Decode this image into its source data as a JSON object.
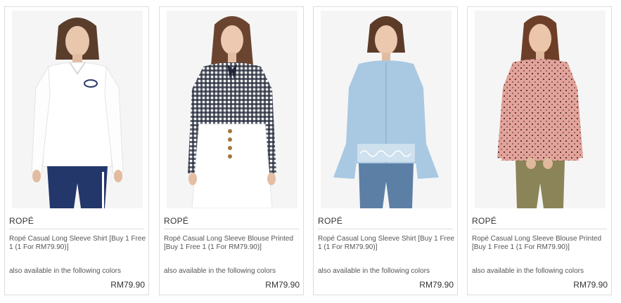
{
  "products": [
    {
      "brand": "ROPÉ",
      "name": "Ropé Casual Long Sleeve Shirt [Buy 1 Free 1 (1 For RM79.90)]",
      "colors_text": "also available in the following colors",
      "price": "RM79.90"
    },
    {
      "brand": "ROPÉ",
      "name": "Ropé Casual Long Sleeve Blouse Printed [Buy 1 Free 1 (1 For RM79.90)]",
      "colors_text": "also available in the following colors",
      "price": "RM79.90"
    },
    {
      "brand": "ROPÉ",
      "name": "Ropé Casual Long Sleeve Shirt [Buy 1 Free 1 (1 For RM79.90)]",
      "colors_text": "also available in the following colors",
      "price": "RM79.90"
    },
    {
      "brand": "ROPÉ",
      "name": "Ropé Casual Long Sleeve Blouse Printed [Buy 1 Free 1 (1 For RM79.90)]",
      "colors_text": "also available in the following colors",
      "price": "RM79.90"
    }
  ]
}
